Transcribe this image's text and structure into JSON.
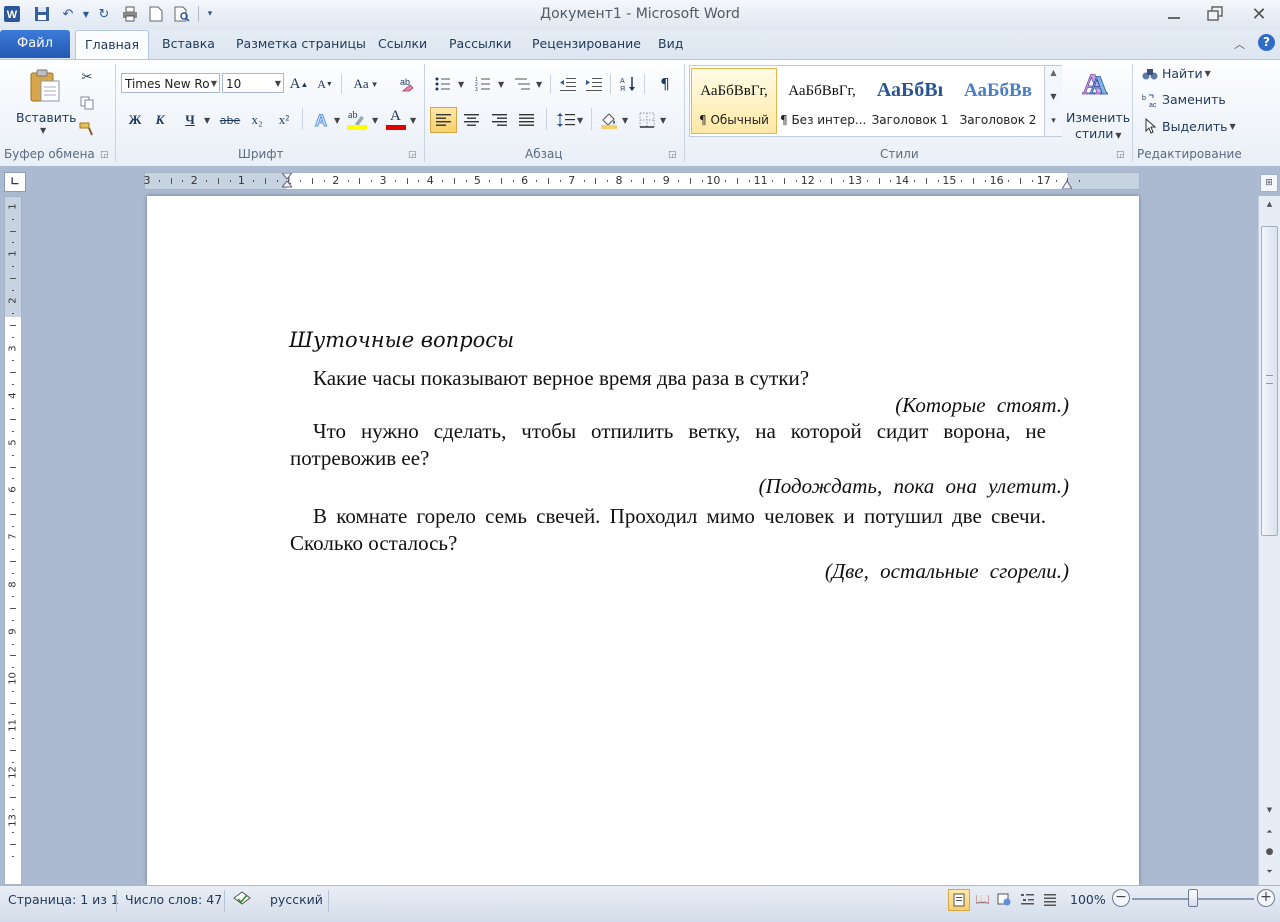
{
  "window": {
    "title": "Документ1 - Microsoft Word"
  },
  "tabs": {
    "file": "Файл",
    "home": "Главная",
    "items": [
      "Вставка",
      "Разметка страницы",
      "Ссылки",
      "Рассылки",
      "Рецензирование",
      "Вид"
    ]
  },
  "ribbon": {
    "clipboard": {
      "paste_label": "Вставить",
      "group_label": "Буфер обмена"
    },
    "font": {
      "font_name": "Times New Ro",
      "font_size": "10",
      "grow": "A",
      "shrink": "A",
      "case": "Aa",
      "bold": "Ж",
      "italic": "К",
      "underline": "Ч",
      "strike": "abe",
      "subscript": "x₂",
      "superscript": "x²",
      "highlight_text": "ab",
      "font_color": "A",
      "group_label": "Шрифт"
    },
    "paragraph": {
      "pilcrow": "¶",
      "group_label": "Абзац"
    },
    "styles": {
      "items": [
        {
          "sample": "АаБбВвГг,",
          "name": "¶ Обычный"
        },
        {
          "sample": "АаБбВвГг,",
          "name": "¶ Без интер..."
        },
        {
          "sample": "АаБбВı",
          "name": "Заголовок 1"
        },
        {
          "sample": "АаБбВв",
          "name": "Заголовок 2"
        }
      ],
      "change_label_1": "Изменить",
      "change_label_2": "стили",
      "group_label": "Стили"
    },
    "editing": {
      "find": "Найти",
      "replace": "Заменить",
      "select": "Выделить",
      "group_label": "Редактирование"
    }
  },
  "ruler": {
    "h_numbers": [
      "3",
      "2",
      "1",
      "1",
      "2",
      "3",
      "4",
      "5",
      "6",
      "7",
      "8",
      "9",
      "10",
      "11",
      "12",
      "13",
      "14",
      "15",
      "16",
      "17"
    ],
    "v_numbers": [
      "1",
      "1",
      "2",
      "3",
      "4",
      "5",
      "6",
      "7",
      "8",
      "9",
      "10",
      "11",
      "12",
      "13"
    ]
  },
  "document": {
    "heading": "Шуточные вопросы",
    "q1": "Какие часы показывают верное время два раза в сутки?",
    "a1": "(Которые стоят.)",
    "q2": "Что нужно сделать, чтобы отпилить ветку, на которой сидит ворона, не потревожив ее?",
    "a2": "(Подождать, пока она улетит.)",
    "q3": "В комнате горело семь свечей. Проходил мимо человек и потушил две свечи. Сколько осталось?",
    "a3": "(Две, остальные сгорели.)"
  },
  "status": {
    "page": "Страница: 1 из 1",
    "words": "Число слов: 47",
    "language": "русский",
    "zoom": "100%"
  },
  "colors": {
    "accent": "#2b579a",
    "file_tab": "#2f67c4",
    "doc_bg": "#abbad1",
    "highlight": "#ffff00",
    "font_color_bar": "#e00000"
  }
}
